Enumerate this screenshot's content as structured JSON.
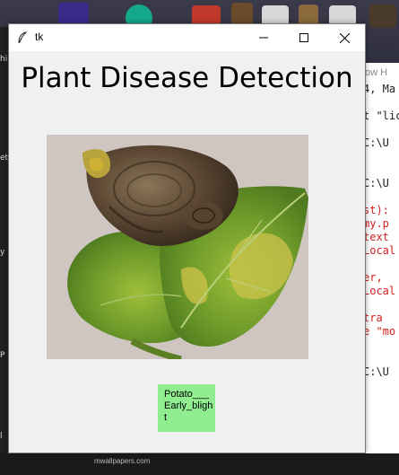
{
  "window": {
    "title": "tk",
    "controls": [
      "minimize-icon",
      "maximize-icon",
      "close-icon"
    ]
  },
  "app": {
    "heading": "Plant Disease Detection",
    "prediction": "Potato___Early_blight"
  },
  "colors": {
    "window_bg": "#f0f0f0",
    "result_bg": "#90ee90"
  },
  "background_editor": {
    "menu": "ow  H",
    "lines": [
      {
        "text": "4, Ma",
        "class": "dark"
      },
      {
        "text": "",
        "class": "dark"
      },
      {
        "text": "t \"lic",
        "class": "dark"
      },
      {
        "text": "",
        "class": "dark"
      },
      {
        "text": "C:\\U",
        "class": "dark"
      },
      {
        "text": "",
        "class": "dark"
      },
      {
        "text": "",
        "class": "dark"
      },
      {
        "text": "C:\\U",
        "class": "dark"
      },
      {
        "text": "",
        "class": "dark"
      },
      {
        "text": "st):",
        "class": "red"
      },
      {
        "text": "my.p",
        "class": "red"
      },
      {
        "text": " text",
        "class": "red"
      },
      {
        "text": "Local",
        "class": "red"
      },
      {
        "text": "",
        "class": "dark"
      },
      {
        "text": "er,",
        "class": "red"
      },
      {
        "text": "Local",
        "class": "red"
      },
      {
        "text": "",
        "class": "dark"
      },
      {
        "text": "tra ",
        "class": "red"
      },
      {
        "text": "e \"mo",
        "class": "red"
      },
      {
        "text": "",
        "class": "dark"
      },
      {
        "text": "",
        "class": "dark"
      },
      {
        "text": "C:\\U",
        "class": "dark"
      }
    ]
  },
  "left_strip": [
    "hi",
    "et",
    "y",
    "P",
    "l"
  ],
  "wallpaper_text": "mwallpapers.com"
}
